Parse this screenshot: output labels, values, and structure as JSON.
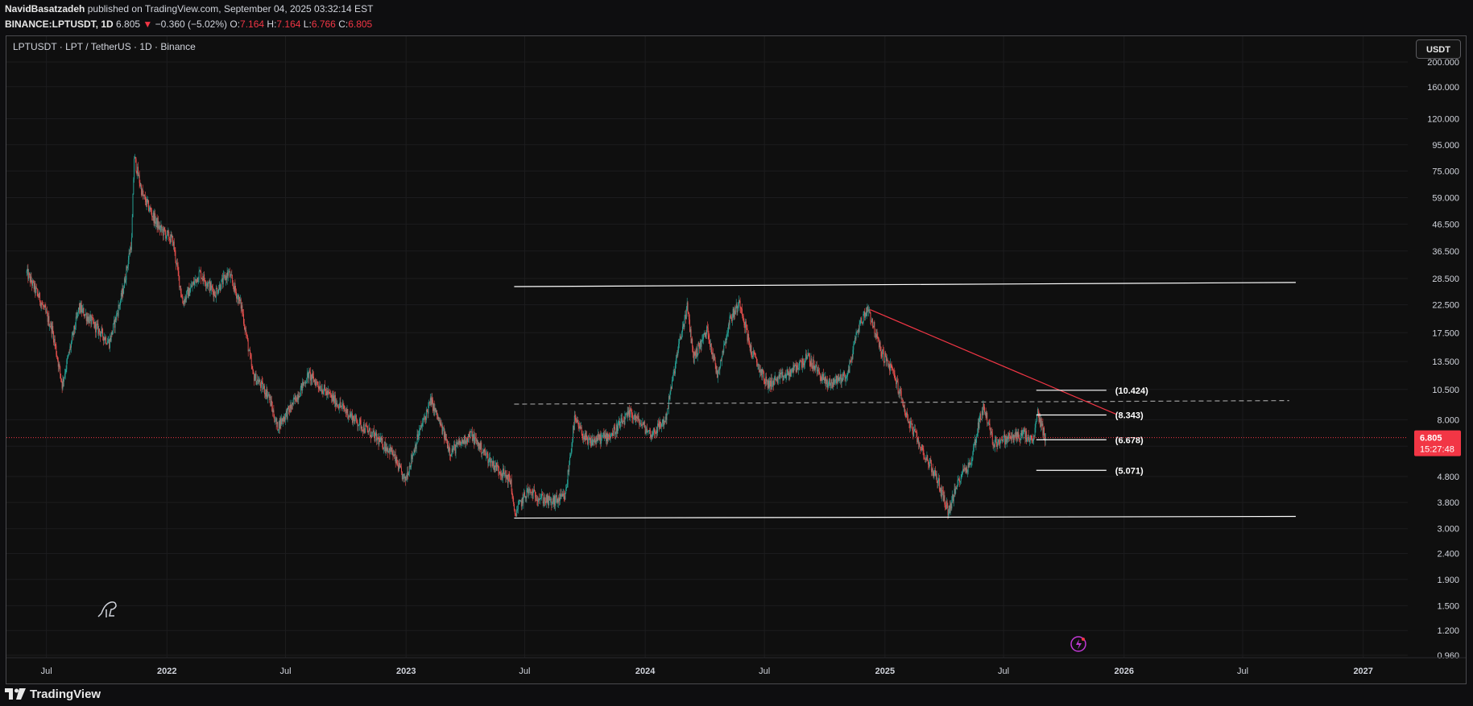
{
  "header": {
    "author": "NavidBasatzadeh",
    "published_text": "published on TradingView.com, September 04, 2025 03:32:14 EST",
    "symbol": "BINANCE:LPTUSDT, 1D",
    "price": "6.805",
    "change": "−0.360 (−5.02%)",
    "o_label": "O:",
    "o_value": "7.164",
    "h_label": "H:",
    "h_value": "7.164",
    "l_label": "L:",
    "l_value": "6.766",
    "c_label": "C:",
    "c_value": "6.805"
  },
  "chart_title": "LPTUSDT · LPT / TetherUS · 1D · Binance",
  "currency_button": "USDT",
  "footer": {
    "brand": "TradingView"
  },
  "colors": {
    "up": "#26a69a",
    "down": "#ef5350",
    "line": "#ffffff",
    "trend": "#f23645",
    "label_bg": "#f23645"
  },
  "chart_data": {
    "type": "candlestick",
    "title": "LPTUSDT · LPT / TetherUS · 1D · Binance",
    "y_scale": "log",
    "ylim": [
      0.96,
      200
    ],
    "y_ticks": [
      "200.000",
      "160.000",
      "120.000",
      "95.000",
      "75.000",
      "59.000",
      "46.500",
      "36.500",
      "28.500",
      "22.500",
      "17.500",
      "13.500",
      "10.500",
      "8.000",
      "6.300",
      "4.800",
      "3.800",
      "3.000",
      "2.400",
      "1.900",
      "1.500",
      "1.200",
      "0.960"
    ],
    "x_range": [
      "2021-05-01",
      "2027-03-10"
    ],
    "x_ticks": [
      {
        "label": "Jul",
        "date": "2021-07-01"
      },
      {
        "label": "2022",
        "date": "2022-01-01"
      },
      {
        "label": "Jul",
        "date": "2022-07-01"
      },
      {
        "label": "2023",
        "date": "2023-01-01"
      },
      {
        "label": "Jul",
        "date": "2023-07-01"
      },
      {
        "label": "2024",
        "date": "2024-01-01"
      },
      {
        "label": "Jul",
        "date": "2024-07-01"
      },
      {
        "label": "2025",
        "date": "2025-01-01"
      },
      {
        "label": "Jul",
        "date": "2025-07-01"
      },
      {
        "label": "2026",
        "date": "2026-01-01"
      },
      {
        "label": "Jul",
        "date": "2026-07-01"
      },
      {
        "label": "2027",
        "date": "2027-01-01"
      }
    ],
    "price_path": [
      [
        "2021-06-01",
        30
      ],
      [
        "2021-06-20",
        24
      ],
      [
        "2021-07-10",
        18
      ],
      [
        "2021-07-25",
        11
      ],
      [
        "2021-08-20",
        22
      ],
      [
        "2021-09-10",
        19
      ],
      [
        "2021-10-05",
        16
      ],
      [
        "2021-10-25",
        25
      ],
      [
        "2021-11-08",
        40
      ],
      [
        "2021-11-12",
        85
      ],
      [
        "2021-11-25",
        60
      ],
      [
        "2021-12-20",
        45
      ],
      [
        "2022-01-10",
        40
      ],
      [
        "2022-01-25",
        23
      ],
      [
        "2022-02-20",
        30
      ],
      [
        "2022-03-15",
        25
      ],
      [
        "2022-04-05",
        30
      ],
      [
        "2022-04-25",
        22
      ],
      [
        "2022-05-12",
        12
      ],
      [
        "2022-06-05",
        10
      ],
      [
        "2022-06-18",
        7.5
      ],
      [
        "2022-07-10",
        9
      ],
      [
        "2022-08-05",
        12
      ],
      [
        "2022-09-05",
        10
      ],
      [
        "2022-10-15",
        8
      ],
      [
        "2022-11-10",
        7
      ],
      [
        "2022-12-10",
        6
      ],
      [
        "2022-12-30",
        4.6
      ],
      [
        "2023-01-20",
        7
      ],
      [
        "2023-02-08",
        9.5
      ],
      [
        "2023-03-10",
        6
      ],
      [
        "2023-04-10",
        7
      ],
      [
        "2023-05-10",
        5.5
      ],
      [
        "2023-06-10",
        4.6
      ],
      [
        "2023-06-15",
        3.4
      ],
      [
        "2023-07-05",
        4.2
      ],
      [
        "2023-08-10",
        3.8
      ],
      [
        "2023-09-01",
        4
      ],
      [
        "2023-09-15",
        8
      ],
      [
        "2023-10-05",
        6.5
      ],
      [
        "2023-11-10",
        7
      ],
      [
        "2023-12-10",
        8.5
      ],
      [
        "2024-01-10",
        7
      ],
      [
        "2024-02-01",
        8
      ],
      [
        "2024-02-20",
        15
      ],
      [
        "2024-03-05",
        22
      ],
      [
        "2024-03-15",
        14
      ],
      [
        "2024-04-05",
        18
      ],
      [
        "2024-04-20",
        12
      ],
      [
        "2024-05-10",
        20
      ],
      [
        "2024-05-25",
        23
      ],
      [
        "2024-06-10",
        15
      ],
      [
        "2024-07-05",
        11
      ],
      [
        "2024-08-05",
        12
      ],
      [
        "2024-09-05",
        14
      ],
      [
        "2024-10-05",
        11
      ],
      [
        "2024-11-05",
        12
      ],
      [
        "2024-11-20",
        18
      ],
      [
        "2024-12-06",
        22
      ],
      [
        "2024-12-25",
        15
      ],
      [
        "2025-01-15",
        12
      ],
      [
        "2025-02-05",
        8
      ],
      [
        "2025-02-28",
        6
      ],
      [
        "2025-03-20",
        4.8
      ],
      [
        "2025-04-08",
        3.5
      ],
      [
        "2025-04-28",
        5
      ],
      [
        "2025-05-12",
        5.4
      ],
      [
        "2025-05-25",
        8
      ],
      [
        "2025-06-01",
        9
      ],
      [
        "2025-06-15",
        6.5
      ],
      [
        "2025-07-10",
        6.8
      ],
      [
        "2025-08-01",
        7
      ],
      [
        "2025-08-15",
        6.5
      ],
      [
        "2025-08-22",
        8.5
      ],
      [
        "2025-09-03",
        6.8
      ]
    ],
    "last_price": "6.805",
    "countdown": "15:27:48",
    "drawings": {
      "channel_top": [
        [
          "2023-06-15",
          26.5
        ],
        [
          "2026-09-20",
          27.5
        ]
      ],
      "channel_bottom": [
        [
          "2023-06-15",
          3.3
        ],
        [
          "2026-09-20",
          3.35
        ]
      ],
      "trendline": [
        [
          "2024-12-10",
          21.5
        ],
        [
          "2025-12-20",
          8.4
        ]
      ],
      "dashed_level": [
        [
          "2023-06-15",
          9.2
        ],
        [
          "2026-09-10",
          9.5
        ]
      ],
      "level_lines": [
        {
          "label": "(10.424)",
          "value": 10.424,
          "from": "2025-08-20",
          "to": "2025-12-05"
        },
        {
          "label": "(8.343)",
          "value": 8.343,
          "from": "2025-08-20",
          "to": "2025-12-05"
        },
        {
          "label": "(6.678)",
          "value": 6.678,
          "from": "2025-08-20",
          "to": "2025-12-05"
        },
        {
          "label": "(5.071)",
          "value": 5.071,
          "from": "2025-08-20",
          "to": "2025-12-05"
        }
      ]
    }
  }
}
